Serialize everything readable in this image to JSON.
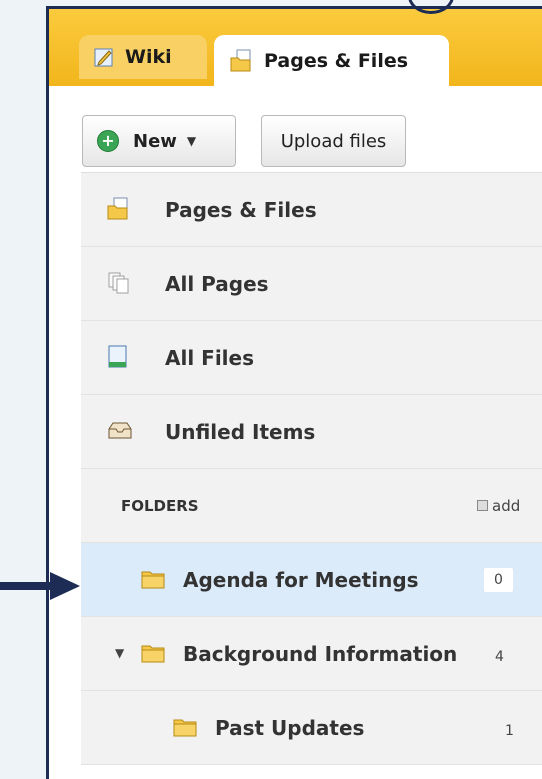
{
  "tabs": [
    {
      "label": "Wiki",
      "icon": "wiki-edit-icon"
    },
    {
      "label": "Pages & Files",
      "icon": "pages-files-icon"
    }
  ],
  "toolbar": {
    "new_label": "New",
    "new_caret": "▼",
    "upload_label": "Upload files"
  },
  "nav": {
    "items": [
      {
        "label": "Pages & Files",
        "icon": "pages-files-icon"
      },
      {
        "label": "All Pages",
        "icon": "all-pages-icon"
      },
      {
        "label": "All Files",
        "icon": "file-icon"
      },
      {
        "label": "Unfiled Items",
        "icon": "inbox-tray-icon"
      }
    ],
    "folders_heading": "FOLDERS",
    "add_label": "add",
    "folders": [
      {
        "label": "Agenda for Meetings",
        "count": "0",
        "selected": true
      },
      {
        "label": "Background Information",
        "count": "4",
        "expanded": true
      },
      {
        "label": "Past Updates",
        "count": "1"
      }
    ]
  },
  "colors": {
    "accent": "#f2b51c",
    "selected_row": "#dcebfa",
    "frame": "#1c2c54"
  }
}
